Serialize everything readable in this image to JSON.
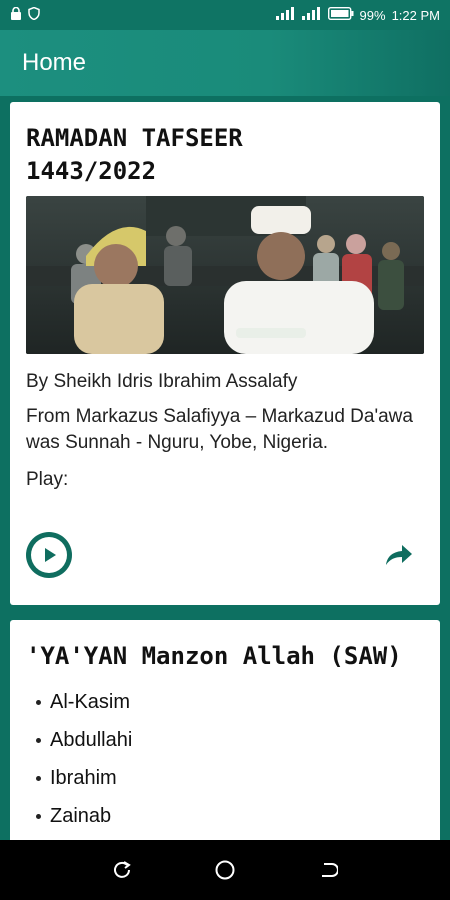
{
  "status_bar": {
    "battery": "99%",
    "time": "1:22 PM"
  },
  "app_bar": {
    "title": "Home"
  },
  "cards": [
    {
      "title_line1": "RAMADAN TAFSEER",
      "title_line2": "1443/2022",
      "author": "By Sheikh Idris Ibrahim Assalafy",
      "description": "From Markazus Salafiyya – Markazud Da'awa was Sunnah - Nguru, Yobe, Nigeria.",
      "play_label": "Play:"
    },
    {
      "title": "'YA'YAN Manzon Allah (SAW)",
      "items": [
        "Al-Kasim",
        "Abdullahi",
        "Ibrahim",
        "Zainab"
      ]
    }
  ],
  "colors": {
    "primary": "#0f7464",
    "accent": "#1a8b7a"
  }
}
